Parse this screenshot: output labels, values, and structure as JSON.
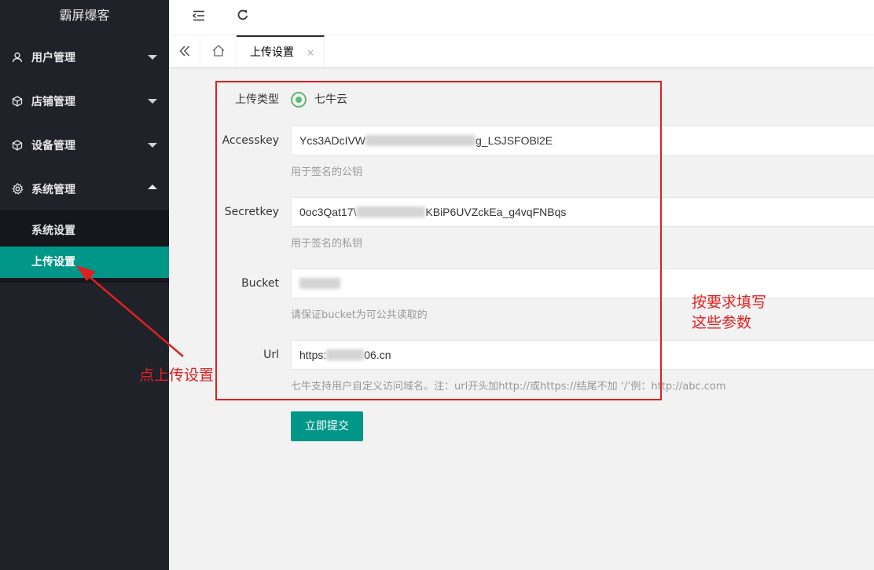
{
  "app": {
    "title": "霸屏爆客"
  },
  "sidebar": {
    "items": [
      {
        "label": "用户管理",
        "icon": "user-icon",
        "expanded": false
      },
      {
        "label": "店铺管理",
        "icon": "cube-icon",
        "expanded": false
      },
      {
        "label": "设备管理",
        "icon": "cube-icon",
        "expanded": false
      },
      {
        "label": "系统管理",
        "icon": "gear-icon",
        "expanded": true
      }
    ],
    "subitems": [
      {
        "label": "系统设置",
        "active": false
      },
      {
        "label": "上传设置",
        "active": true
      }
    ]
  },
  "header": {
    "menu_toggle_icon": "menu-fold-icon",
    "refresh_icon": "refresh-icon"
  },
  "tabs": {
    "current": "上传设置",
    "close": "×"
  },
  "form": {
    "upload_type": {
      "label": "上传类型",
      "option": "七牛云"
    },
    "accesskey": {
      "label": "Accesskey",
      "value_start": "Ycs3ADcIVW",
      "value_end": "g_LSJSFOBl2E",
      "tip": "用于签名的公钥"
    },
    "secretkey": {
      "label": "Secretkey",
      "value_start": "0oc3Qat17\\",
      "value_end": "KBiP6UVZckEa_g4vqFNBqs",
      "tip": "用于签名的私钥"
    },
    "bucket": {
      "label": "Bucket",
      "tip": "请保证bucket为可公共读取的"
    },
    "url": {
      "label": "Url",
      "value_start": "https:",
      "value_end": "06.cn",
      "tip": "七牛支持用户自定义访问域名。注：url开头加http://或https://结尾不加 ‘/’例：http://abc.com"
    },
    "submit_label": "立即提交"
  },
  "annotations": {
    "click_hint": "点上传设置",
    "fill_hint_line1": "按要求填写",
    "fill_hint_line2": "这些参数"
  },
  "colors": {
    "sidebar_bg": "#20222a",
    "active": "#009688",
    "radio": "#5fb878",
    "annotation": "#e02020"
  }
}
